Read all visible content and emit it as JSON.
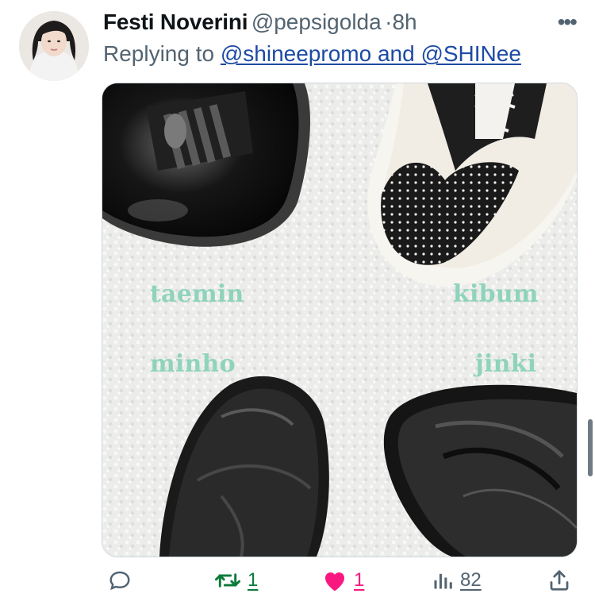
{
  "tweet": {
    "author_name": "Festi Noverini",
    "handle": "@pepsigolda",
    "separator": "·",
    "time": "8h",
    "more_label": "•••",
    "reply_prefix": "Replying to",
    "reply_to": "@shineepromo and @SHINee"
  },
  "image": {
    "labels": {
      "top_left": "taemin",
      "top_right": "kibum",
      "bottom_left": "minho",
      "bottom_right": "jinki"
    },
    "label_color": "#8fd3bd"
  },
  "actions": {
    "reply_count": "",
    "retweet_count": "1",
    "like_count": "1",
    "views_count": "82"
  },
  "colors": {
    "retweet": "#0b7a3b",
    "like": "#f91880",
    "link": "#1d4aa3",
    "muted": "#536471"
  }
}
